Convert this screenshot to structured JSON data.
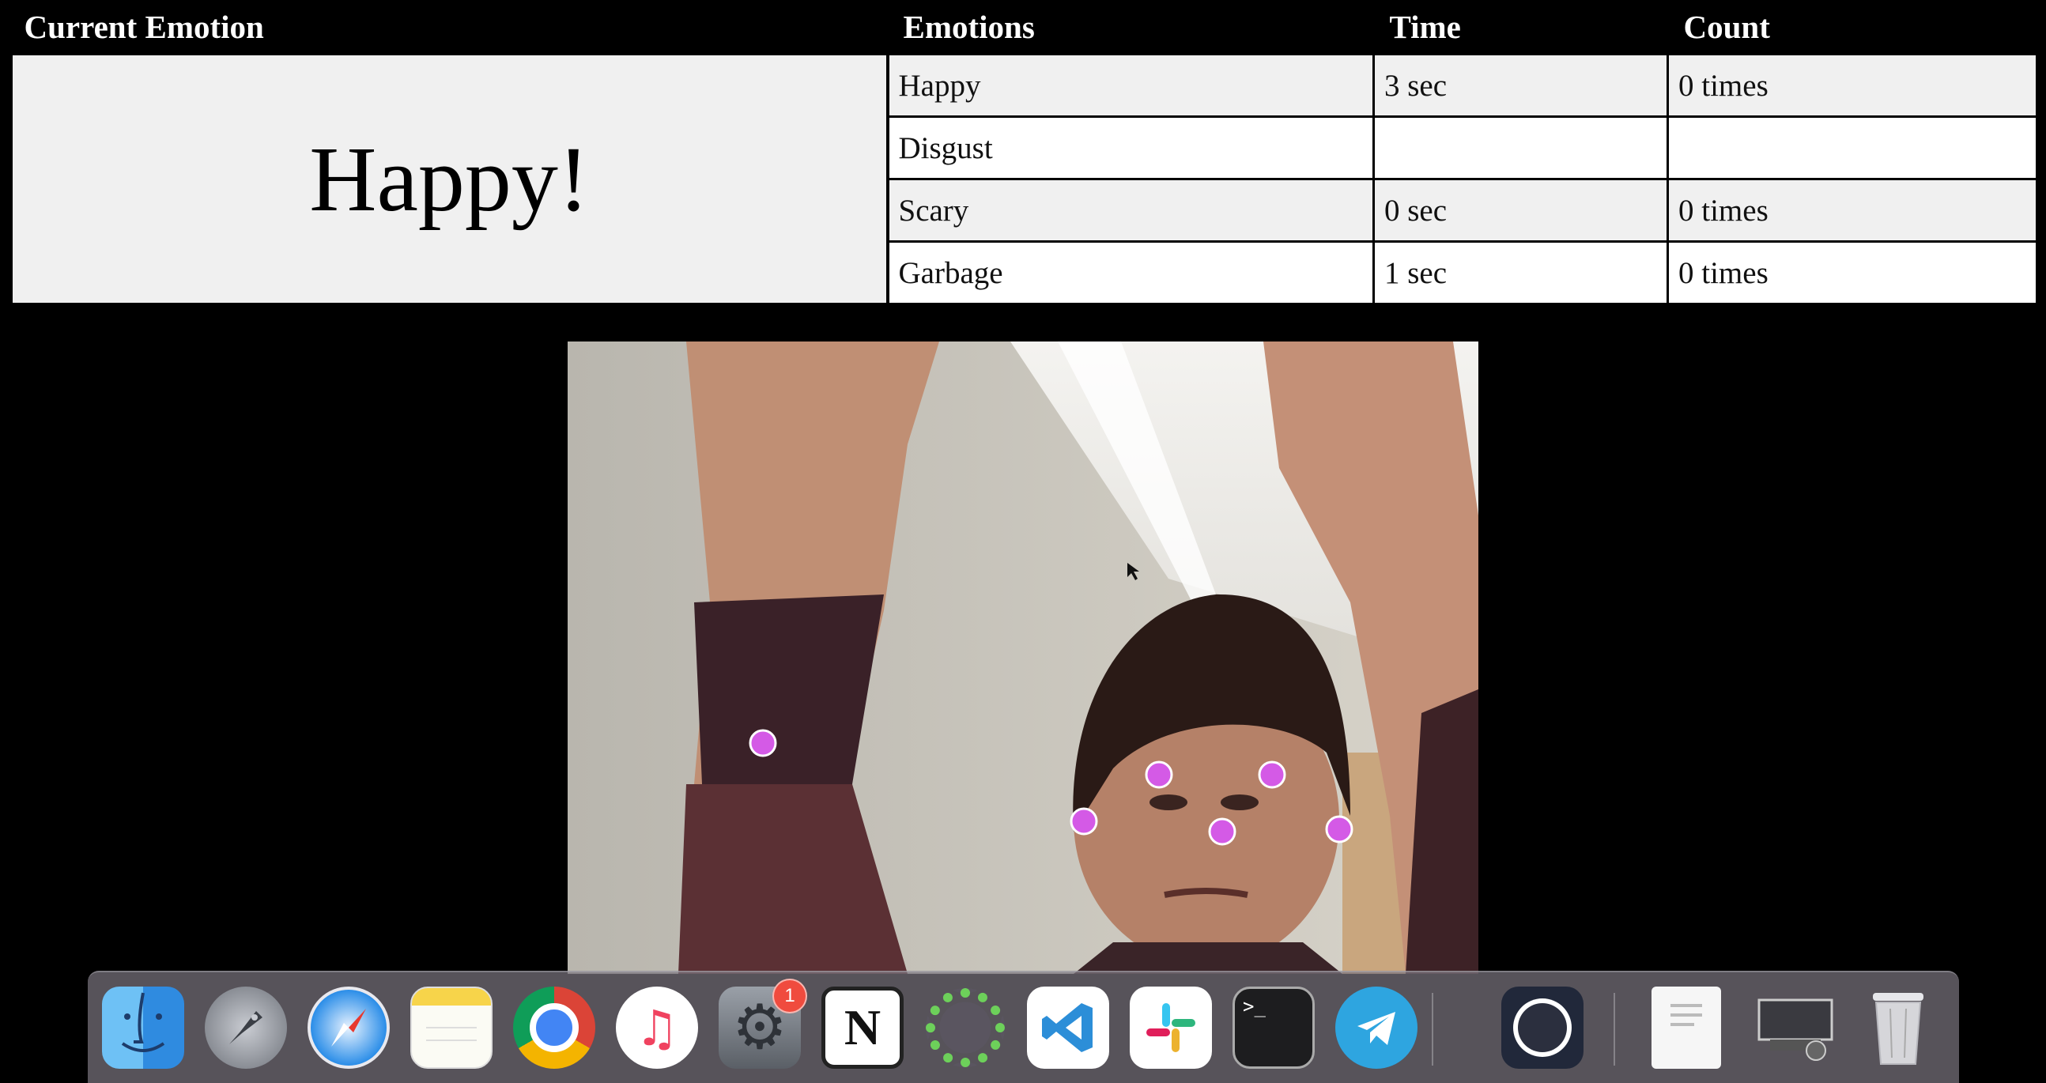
{
  "table": {
    "headers": {
      "current_emotion": "Current Emotion",
      "emotions": "Emotions",
      "time": "Time",
      "count": "Count"
    },
    "current_emotion_value": "Happy!",
    "rows": [
      {
        "emotion": "Happy",
        "time": "3 sec",
        "count": "0 times"
      },
      {
        "emotion": "Disgust",
        "time": "",
        "count": ""
      },
      {
        "emotion": "Scary",
        "time": "0 sec",
        "count": "0 times"
      },
      {
        "emotion": "Garbage",
        "time": "1 sec",
        "count": "0 times"
      }
    ]
  },
  "webcam": {
    "keypoint_color": "#d45ae6",
    "keypoint_names": [
      "left-wrist",
      "left-eye",
      "right-eye",
      "left-ear",
      "nose",
      "right-ear"
    ]
  },
  "dock": {
    "items": [
      {
        "name": "finder-icon",
        "label": ""
      },
      {
        "name": "launchpad-icon",
        "label": ""
      },
      {
        "name": "safari-icon",
        "label": ""
      },
      {
        "name": "notes-icon",
        "label": ""
      },
      {
        "name": "chrome-icon",
        "label": ""
      },
      {
        "name": "music-icon",
        "label": ""
      },
      {
        "name": "system-preferences-icon",
        "label": "",
        "badge": "1"
      },
      {
        "name": "notion-icon",
        "label": "N"
      },
      {
        "name": "app-loading-ring-icon",
        "label": ""
      },
      {
        "name": "vscode-icon",
        "label": ""
      },
      {
        "name": "slack-icon",
        "label": ""
      },
      {
        "name": "terminal-icon",
        "label": ">_"
      },
      {
        "name": "telegram-icon",
        "label": ""
      },
      {
        "name": "obs-icon",
        "label": ""
      },
      {
        "name": "document-icon",
        "label": ""
      },
      {
        "name": "screenshot-folder-icon",
        "label": ""
      },
      {
        "name": "trash-icon",
        "label": ""
      }
    ],
    "colors": {
      "dock_bg": "#7a7480",
      "vscode": "#2c8ed8",
      "telegram": "#2ea5e0",
      "chrome_red": "#db4437",
      "chrome_green": "#0f9d58",
      "chrome_yellow": "#f4b400",
      "chrome_blue": "#4285f4"
    }
  }
}
